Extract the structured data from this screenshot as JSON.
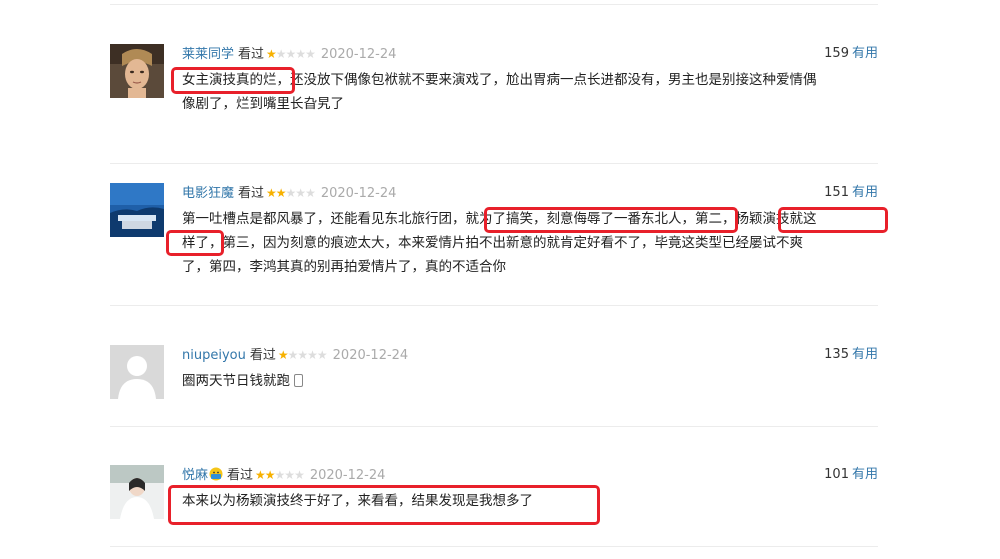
{
  "reviews": [
    {
      "user": "莱莱同学",
      "action": "看过",
      "stars": 1,
      "date": "2020-12-24",
      "votes": "159",
      "useful_label": "有用",
      "line1": "女主演技真的烂，还没放下偶像包袱就不要来演戏了，尬出胃病一点长进都没有，男主也是别接这种爱情偶",
      "line2": "像剧了，烂到嘴里长旮旯了"
    },
    {
      "user": "电影狂魔",
      "action": "看过",
      "stars": 2,
      "date": "2020-12-24",
      "votes": "151",
      "useful_label": "有用",
      "line1": "第一吐槽点是都风暴了，还能看见东北旅行团，就为了搞笑，刻意侮辱了一番东北人，第二，杨颖演技就这",
      "line2": "样了，第三，因为刻意的痕迹太大，本来爱情片拍不出新意的就肯定好看不了，毕竟这类型已经屡试不爽",
      "line3": "了，第四，李鸿其真的别再拍爱情片了，真的不适合你"
    },
    {
      "user": "niupeiyou",
      "action": "看过",
      "stars": 1,
      "date": "2020-12-24",
      "votes": "135",
      "useful_label": "有用",
      "line1": "圈两天节日钱就跑"
    },
    {
      "user": "悦麻",
      "action": "看过",
      "stars": 2,
      "date": "2020-12-24",
      "votes": "101",
      "useful_label": "有用",
      "line1": "本来以为杨颖演技终于好了，来看看，结果发现是我想多了"
    }
  ],
  "colors": {
    "link": "#3377aa",
    "star": "#f7b100",
    "highlight": "#e8202a"
  }
}
